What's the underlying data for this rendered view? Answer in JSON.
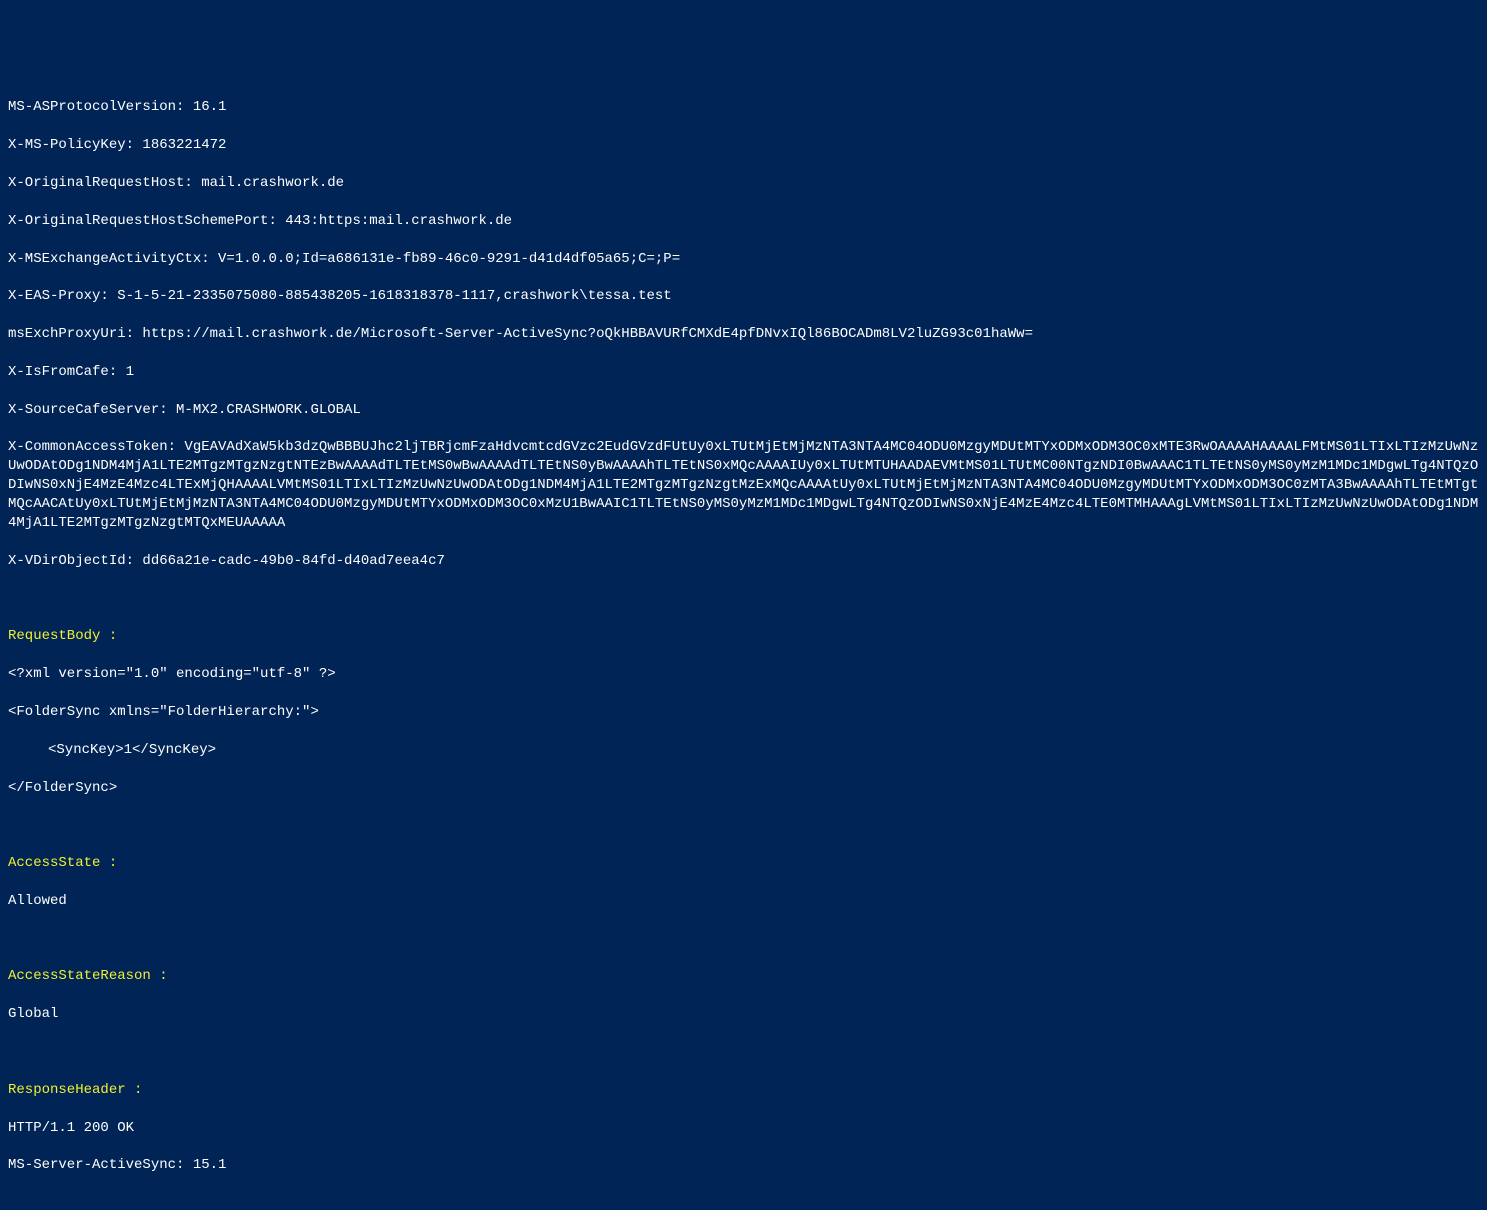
{
  "headers": {
    "asProtocolVersion": "MS-ASProtocolVersion: 16.1",
    "policyKey": "X-MS-PolicyKey: 1863221472",
    "origRequestHost": "X-OriginalRequestHost: mail.crashwork.de",
    "origRequestHostSchemePort": "X-OriginalRequestHostSchemePort: 443:https:mail.crashwork.de",
    "msExchActivityCtx": "X-MSExchangeActivityCtx: V=1.0.0.0;Id=a686131e-fb89-46c0-9291-d41d4df05a65;C=;P=",
    "easProxy": "X-EAS-Proxy: S-1-5-21-2335075080-885438205-1618318378-1117,crashwork\\tessa.test",
    "msExchProxyUri": "msExchProxyUri: https://mail.crashwork.de/Microsoft-Server-ActiveSync?oQkHBBAVURfCMXdE4pfDNvxIQl86BOCADm8LV2luZG93c01haWw=",
    "isFromCafe": "X-IsFromCafe: 1",
    "sourceCafeServer": "X-SourceCafeServer: M-MX2.CRASHWORK.GLOBAL",
    "commonAccessToken": "X-CommonAccessToken: VgEAVAdXaW5kb3dzQwBBBUJhc2ljTBRjcmFzaHdvcmtcdGVzc2EudGVzdFUtUy0xLTUtMjEtMjMzNTA3NTA4MC04ODU0MzgyMDUtMTYxODMxODM3OC0xMTE3RwOAAAAHAAAALFMtMS01LTIxLTIzMzUwNzUwODAtODg1NDM4MjA1LTE2MTgzMTgzNzgtNTEzBwAAAAdTLTEtMS0wBwAAAAdTLTEtNS0yBwAAAAhTLTEtNS0xMQcAAAAIUy0xLTUtMTUHAADAEVMtMS01LTUtMC00NTgzNDI0BwAAAC1TLTEtNS0yMS0yMzM1MDc1MDgwLTg4NTQzODIwNS0xNjE4MzE4Mzc4LTExMjQHAAAALVMtMS01LTIxLTIzMzUwNzUwODAtODg1NDM4MjA1LTE2MTgzMTgzNzgtMzExMQcAAAAtUy0xLTUtMjEtMjMzNTA3NTA4MC04ODU0MzgyMDUtMTYxODMxODM3OC0zMTA3BwAAAAhTLTEtMTgtMQcAACAtUy0xLTUtMjEtMjMzNTA3NTA4MC04ODU0MzgyMDUtMTYxODMxODM3OC0xMzU1BwAAIC1TLTEtNS0yMS0yMzM1MDc1MDgwLTg4NTQzODIwNS0xNjE4MzE4Mzc4LTE0MTMHAAAgLVMtMS01LTIxLTIzMzUwNzUwODAtODg1NDM4MjA1LTE2MTgzMTgzNzgtMTQxMEUAAAAA",
    "vDirObjectId": "X-VDirObjectId: dd66a21e-cadc-49b0-84fd-d40ad7eea4c7"
  },
  "sections": {
    "requestBody": {
      "label": "RequestBody :",
      "line1": "<?xml version=\"1.0\" encoding=\"utf-8\" ?>",
      "line2": "<FolderSync xmlns=\"FolderHierarchy:\">",
      "line3": "<SyncKey>1</SyncKey>",
      "line4": "</FolderSync>"
    },
    "accessState": {
      "label": "AccessState :",
      "value": "Allowed"
    },
    "accessStateReason": {
      "label": "AccessStateReason :",
      "value": "Global"
    },
    "responseHeader": {
      "label": "ResponseHeader :",
      "line1": "HTTP/1.1 200 OK",
      "line2": "MS-Server-ActiveSync: 15.1"
    }
  }
}
